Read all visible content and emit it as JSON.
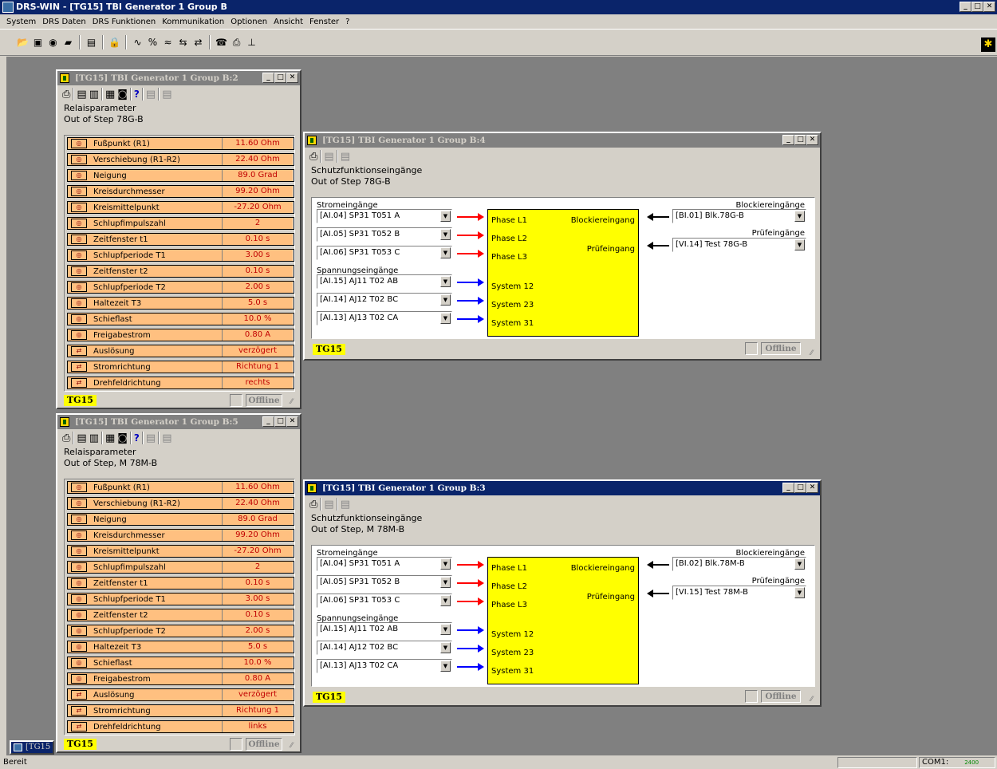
{
  "app_title": "DRS-WIN - [TG15]  TBI Generator 1 Group B",
  "menu": [
    "System",
    "DRS Daten",
    "DRS Funktionen",
    "Kommunikation",
    "Optionen",
    "Ansicht",
    "Fenster",
    "?"
  ],
  "status": {
    "text": "Bereit",
    "port": "COM1:",
    "baud": "2400"
  },
  "colors": {
    "titlebar_active": "#0a246a",
    "titlebar_inactive": "#808080",
    "param_bg": "#ffc080",
    "value_text": "#c00000",
    "highlight": "#ffff00",
    "current_arrow": "#ff0000",
    "voltage_arrow": "#0000ff"
  },
  "win2": {
    "title": "[TG15]  TBI Generator 1 Group B:2",
    "header1": "Relaisparameter",
    "header2": "Out of Step  78G-B",
    "tag": "TG15",
    "status": "Offline",
    "rows": [
      {
        "label": "Fußpunkt (R1)",
        "value": "11.60  Ohm"
      },
      {
        "label": "Verschiebung (R1-R2)",
        "value": "22.40  Ohm"
      },
      {
        "label": "Neigung",
        "value": "89.0  Grad"
      },
      {
        "label": "Kreisdurchmesser",
        "value": "99.20  Ohm"
      },
      {
        "label": "Kreismittelpunkt",
        "value": "-27.20  Ohm"
      },
      {
        "label": "Schlupfimpulszahl",
        "value": "2"
      },
      {
        "label": "Zeitfenster t1",
        "value": "0.10  s"
      },
      {
        "label": "Schlupfperiode T1",
        "value": "3.00  s"
      },
      {
        "label": "Zeitfenster t2",
        "value": "0.10  s"
      },
      {
        "label": "Schlupfperiode T2",
        "value": "2.00  s"
      },
      {
        "label": "Haltezeit T3",
        "value": "5.0  s"
      },
      {
        "label": "Schieflast",
        "value": "10.0  %"
      },
      {
        "label": "Freigabestrom",
        "value": "0.80  A"
      },
      {
        "label": "Auslösung",
        "value": "verzögert"
      },
      {
        "label": "Stromrichtung",
        "value": "Richtung 1"
      },
      {
        "label": "Drehfeldrichtung",
        "value": "rechts"
      }
    ]
  },
  "win5": {
    "title": "[TG15]  TBI Generator 1 Group B:5",
    "header1": "Relaisparameter",
    "header2": "Out of Step, M  78M-B",
    "tag": "TG15",
    "status": "Offline",
    "rows": [
      {
        "label": "Fußpunkt (R1)",
        "value": "11.60  Ohm"
      },
      {
        "label": "Verschiebung (R1-R2)",
        "value": "22.40  Ohm"
      },
      {
        "label": "Neigung",
        "value": "89.0  Grad"
      },
      {
        "label": "Kreisdurchmesser",
        "value": "99.20  Ohm"
      },
      {
        "label": "Kreismittelpunkt",
        "value": "-27.20  Ohm"
      },
      {
        "label": "Schlupfimpulszahl",
        "value": "2"
      },
      {
        "label": "Zeitfenster t1",
        "value": "0.10  s"
      },
      {
        "label": "Schlupfperiode T1",
        "value": "3.00  s"
      },
      {
        "label": "Zeitfenster t2",
        "value": "0.10  s"
      },
      {
        "label": "Schlupfperiode T2",
        "value": "2.00  s"
      },
      {
        "label": "Haltezeit T3",
        "value": "5.0  s"
      },
      {
        "label": "Schieflast",
        "value": "10.0  %"
      },
      {
        "label": "Freigabestrom",
        "value": "0.80  A"
      },
      {
        "label": "Auslösung",
        "value": "verzögert"
      },
      {
        "label": "Stromrichtung",
        "value": "Richtung 1"
      },
      {
        "label": "Drehfeldrichtung",
        "value": "links"
      }
    ]
  },
  "win4": {
    "title": "[TG15]  TBI Generator 1 Group B:4",
    "header1": "Schutzfunktionseingänge",
    "header2": "Out of Step  78G-B",
    "tag": "TG15",
    "status": "Offline",
    "current_label": "Stromeingänge",
    "voltage_label": "Spannungseingänge",
    "block_label": "Blockiereingänge",
    "test_label": "Prüfeingänge",
    "currents": [
      "[AI.04]  SP31 T051 A",
      "[AI.05]  SP31 T052 B",
      "[AI.06]  SP31 T053 C"
    ],
    "voltages": [
      "[AI.15]  AJ11 T02 AB",
      "[AI.14]  AJ12 T02 BC",
      "[AI.13]  AJ13 T02 CA"
    ],
    "phases": [
      "Phase L1",
      "Phase L2",
      "Phase L3"
    ],
    "systems": [
      "System 12",
      "System 23",
      "System 31"
    ],
    "block_in": "Blockiereingang",
    "test_in": "Prüfeingang",
    "block_sel": "[BI.01]  Blk.78G-B",
    "test_sel": "[VI.14]  Test 78G-B"
  },
  "win3": {
    "title": "[TG15]  TBI Generator 1 Group B:3",
    "header1": "Schutzfunktionseingänge",
    "header2": "Out of Step, M  78M-B",
    "tag": "TG15",
    "status": "Offline",
    "current_label": "Stromeingänge",
    "voltage_label": "Spannungseingänge",
    "block_label": "Blockiereingänge",
    "test_label": "Prüfeingänge",
    "currents": [
      "[AI.04]  SP31 T051 A",
      "[AI.05]  SP31 T052 B",
      "[AI.06]  SP31 T053 C"
    ],
    "voltages": [
      "[AI.15]  AJ11 T02 AB",
      "[AI.14]  AJ12 T02 BC",
      "[AI.13]  AJ13 T02 CA"
    ],
    "phases": [
      "Phase L1",
      "Phase L2",
      "Phase L3"
    ],
    "systems": [
      "System 12",
      "System 23",
      "System 31"
    ],
    "block_in": "Blockiereingang",
    "test_in": "Prüfeingang",
    "block_sel": "[BI.02]  Blk.78M-B",
    "test_sel": "[VI.15]  Test 78M-B"
  },
  "minimized": "[TG15"
}
